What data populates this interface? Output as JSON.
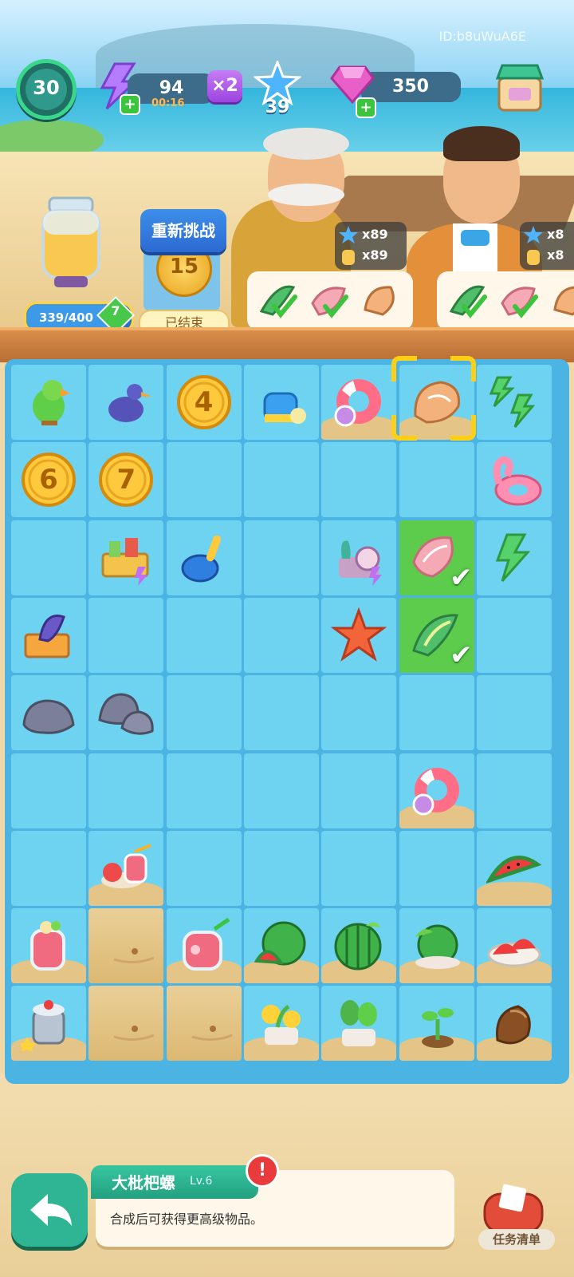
{
  "hud": {
    "player_id": "ID:b8uWuA6E",
    "level": "30",
    "energy": "94",
    "energy_timer": "00:16",
    "multiplier": "×2",
    "stars": "39",
    "gems": "350",
    "plus": "+"
  },
  "left_panel": {
    "jar_progress": "339/400",
    "jar_progress_fraction": 0.85,
    "jar_level": "7",
    "retry_label": "重新挑战",
    "event_coin": "15",
    "event_status": "已结束"
  },
  "rewards": [
    {
      "line1": "x89",
      "line2": "x89"
    },
    {
      "line1": "x8",
      "line2": "x8"
    }
  ],
  "board": {
    "rows": [
      [
        "parrot",
        "heron",
        "coin-4",
        "watering-can",
        "swim-ring",
        "conch-shell",
        "energy-bolts-2"
      ],
      [
        "coin-6",
        "coin-7",
        "",
        "",
        "",
        "",
        "flamingo-float"
      ],
      [
        "",
        "picnic-basket",
        "sand-shovel",
        "",
        "coral-chest",
        "pink-shell",
        "energy-bolt"
      ],
      [
        "surfboard-crate",
        "",
        "",
        "",
        "starfish",
        "green-shell",
        ""
      ],
      [
        "rock",
        "rocks",
        "",
        "",
        "",
        "",
        ""
      ],
      [
        "",
        "",
        "",
        "",
        "",
        "swim-ring",
        ""
      ],
      [
        "",
        "juice-tray",
        "",
        "",
        "",
        "",
        "watermelon-slices"
      ],
      [
        "juice-glass",
        "sand",
        "juice-jug",
        "watermelon",
        "whole-watermelon",
        "watermelon-plant",
        "watermelon-plate"
      ],
      [
        "juicer",
        "sand",
        "sand",
        "flower-pot",
        "sprout-pot",
        "sprout",
        "seed"
      ]
    ],
    "numbers": {
      "coin-4": "4",
      "coin-6": "6",
      "coin-7": "7"
    },
    "sand_cells": [
      "0-4",
      "0-5",
      "5-5",
      "6-1",
      "6-6",
      "7-0",
      "7-1",
      "7-2",
      "7-3",
      "7-4",
      "7-5",
      "7-6",
      "8-1",
      "8-2",
      "8-3",
      "8-4",
      "8-5",
      "8-6",
      "8-0"
    ],
    "done_cells": [
      "2-5",
      "3-5"
    ],
    "selected_cell": "0-5"
  },
  "bottom": {
    "item_name": "大枇杷螺",
    "item_level": "Lv.6",
    "alert": "!",
    "item_desc": "合成后可获得更高级物品。",
    "task_label": "任务清单"
  },
  "colors": {
    "board_bg": "#4bb4e3",
    "cell_bg": "#6dd3f1",
    "done_bg": "#5dcb4c",
    "accent_green": "#39d68c",
    "gem_pink": "#e85fc8"
  }
}
